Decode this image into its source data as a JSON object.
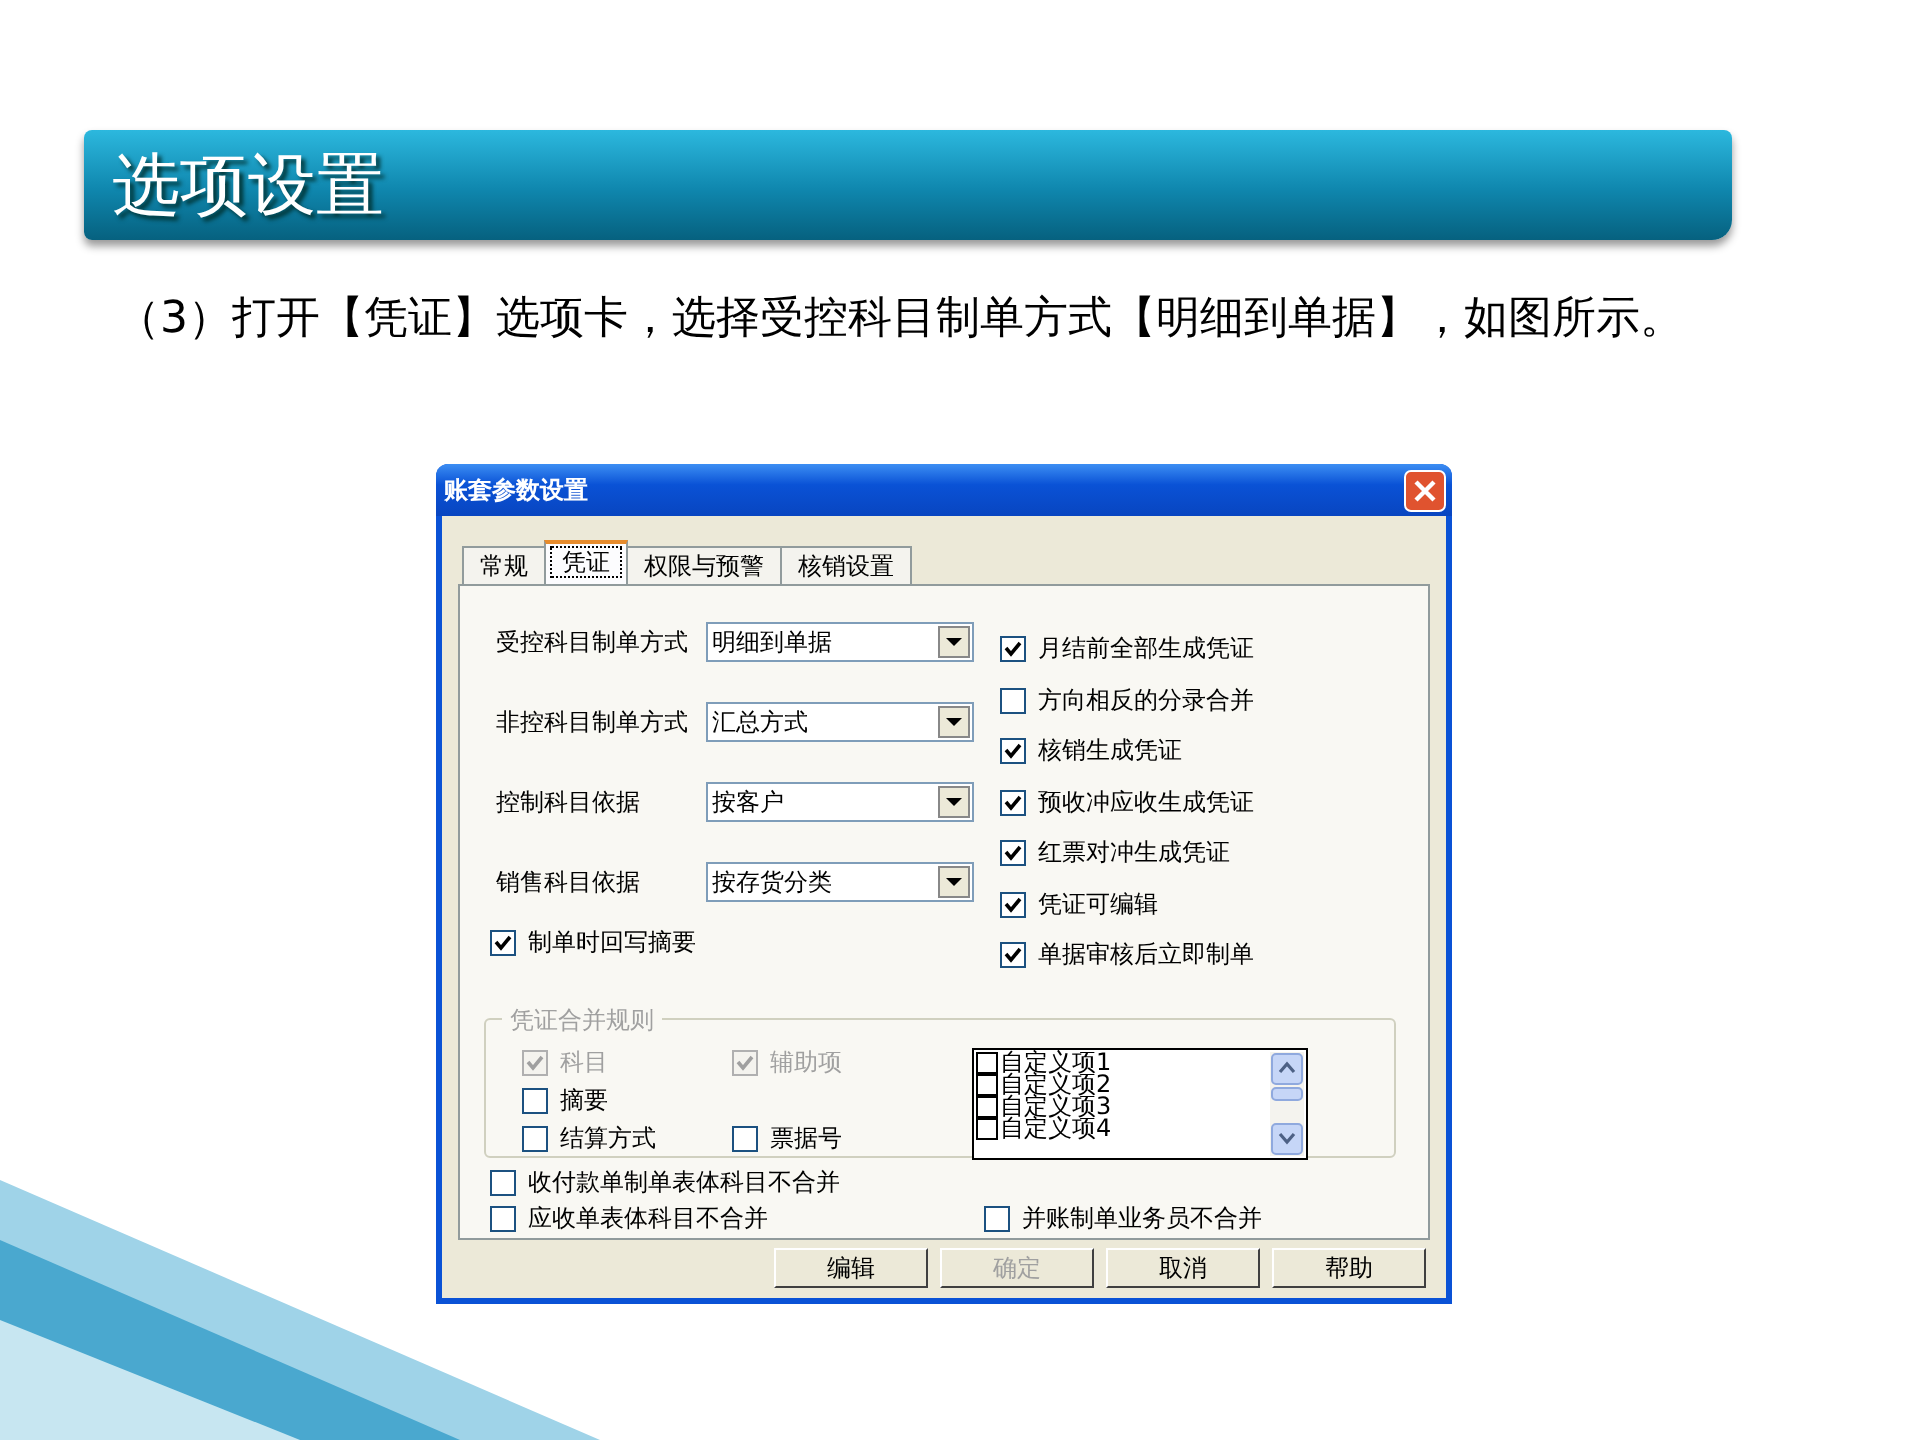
{
  "slide": {
    "title": "选项设置",
    "paragraph": "（3）打开【凭证】选项卡，选择受控科目制单方式【明细到单据】，如图所示。"
  },
  "dialog": {
    "title": "账套参数设置",
    "tabs": [
      {
        "label": "常规",
        "selected": false
      },
      {
        "label": "凭证",
        "selected": true
      },
      {
        "label": "权限与预警",
        "selected": false
      },
      {
        "label": "核销设置",
        "selected": false
      }
    ],
    "dropdowns": [
      {
        "label": "受控科目制单方式",
        "value": "明细到单据"
      },
      {
        "label": "非控科目制单方式",
        "value": "汇总方式"
      },
      {
        "label": "控制科目依据",
        "value": "按客户"
      },
      {
        "label": "销售科目依据",
        "value": "按存货分类"
      }
    ],
    "left_checks": [
      {
        "label": "制单时回写摘要",
        "checked": true
      }
    ],
    "right_checks": [
      {
        "label": "月结前全部生成凭证",
        "checked": true
      },
      {
        "label": "方向相反的分录合并",
        "checked": false
      },
      {
        "label": "核销生成凭证",
        "checked": true
      },
      {
        "label": "预收冲应收生成凭证",
        "checked": true
      },
      {
        "label": "红票对冲生成凭证",
        "checked": true
      },
      {
        "label": "凭证可编辑",
        "checked": true
      },
      {
        "label": "单据审核后立即制单",
        "checked": true
      }
    ],
    "merge_group": {
      "title": "凭证合并规则",
      "rows": [
        {
          "items": [
            {
              "label": "科目",
              "checked": true,
              "disabled": true
            },
            {
              "label": "辅助项",
              "checked": true,
              "disabled": true
            }
          ]
        },
        {
          "items": [
            {
              "label": "摘要",
              "checked": false,
              "disabled": false
            }
          ]
        },
        {
          "items": [
            {
              "label": "结算方式",
              "checked": false,
              "disabled": false
            },
            {
              "label": "票据号",
              "checked": false,
              "disabled": false
            }
          ]
        }
      ],
      "list_items": [
        {
          "label": "自定义项1",
          "checked": false
        },
        {
          "label": "自定义项2",
          "checked": false
        },
        {
          "label": "自定义项3",
          "checked": false
        },
        {
          "label": "自定义项4",
          "checked": false
        }
      ]
    },
    "bottom_rows": [
      {
        "items": [
          {
            "label": "收付款单制单表体科目不合并",
            "checked": false
          }
        ]
      },
      {
        "items": [
          {
            "label": "应收单表体科目不合并",
            "checked": false
          },
          {
            "label": "并账制单业务员不合并",
            "checked": false
          }
        ]
      }
    ],
    "buttons": [
      {
        "label": "编辑",
        "disabled": false
      },
      {
        "label": "确定",
        "disabled": true
      },
      {
        "label": "取消",
        "disabled": false
      },
      {
        "label": "帮助",
        "disabled": false
      }
    ]
  }
}
